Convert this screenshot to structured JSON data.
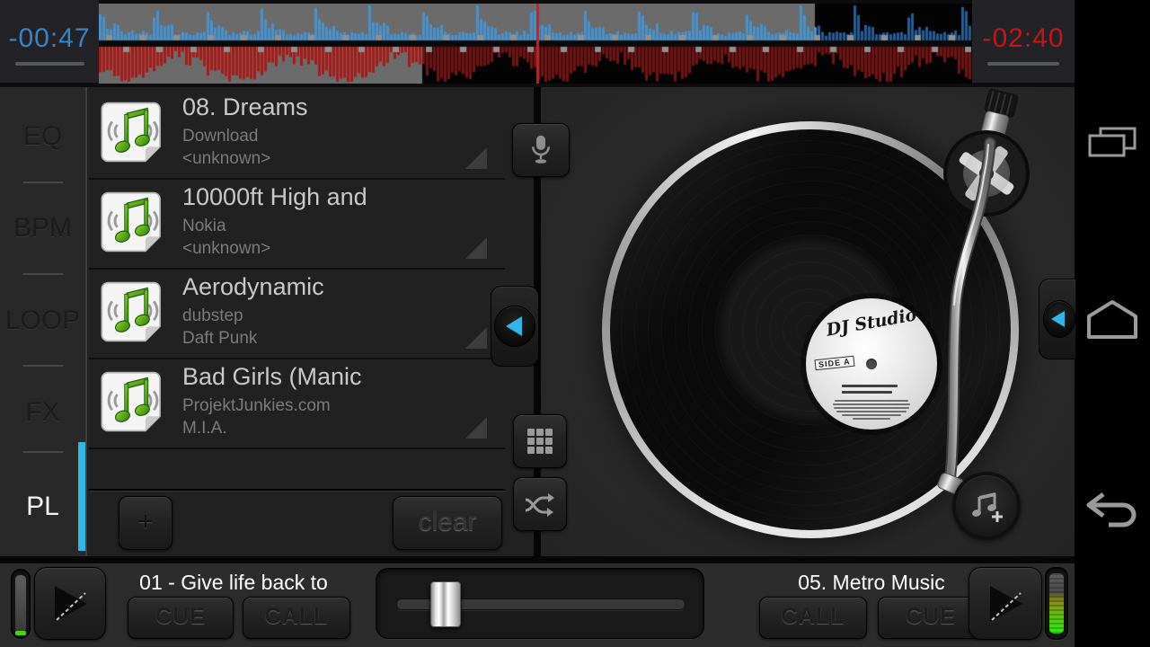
{
  "app": {
    "name": "DJ Studio"
  },
  "top_bar": {
    "deck_a_time": "-00:47",
    "deck_b_time": "-02:40",
    "deck_a_color": "#3584c6",
    "deck_b_color": "#c11717",
    "waveform": {
      "top_progress": 0.82,
      "bottom_progress": 0.37,
      "playhead": 0.502,
      "blue_bright": "#4e8fc4",
      "blue_dark": "#2c5c8e",
      "red_bright": "#9c1f1f",
      "red_dark": "#6e1616",
      "played_bg": "#6b6b6b",
      "unplayed_bg": "#030303",
      "marker_color": "#909090",
      "playhead_color": "#c42222"
    }
  },
  "sidebar": {
    "tabs": [
      {
        "label": "EQ",
        "active": false
      },
      {
        "label": "BPM",
        "active": false
      },
      {
        "label": "LOOP",
        "active": false
      },
      {
        "label": "FX",
        "active": false
      },
      {
        "label": "PL",
        "active": true
      }
    ],
    "active_indicator_color": "#33b5e5"
  },
  "playlist": {
    "tracks": [
      {
        "title": "08. Dreams",
        "line2": "Download",
        "line3": "<unknown>"
      },
      {
        "title": "10000ft High and",
        "line2": "Nokia",
        "line3": "<unknown>"
      },
      {
        "title": "Aerodynamic",
        "line2": "dubstep",
        "line3": "Daft Punk"
      },
      {
        "title": "Bad Girls (Manic",
        "line2": "ProjektJunkies.com",
        "line3": "M.I.A."
      }
    ],
    "add_label": "+",
    "clear_label": "clear"
  },
  "turntable": {
    "brand": "DJ Studio",
    "side": "SIDE A"
  },
  "bottom_bar": {
    "deck_a": {
      "title": "01 - Give life back to",
      "cue_label": "CUE",
      "call_label": "CALL"
    },
    "deck_b": {
      "title": "05. Metro Music",
      "call_label": "CALL",
      "cue_label": "CUE"
    }
  }
}
